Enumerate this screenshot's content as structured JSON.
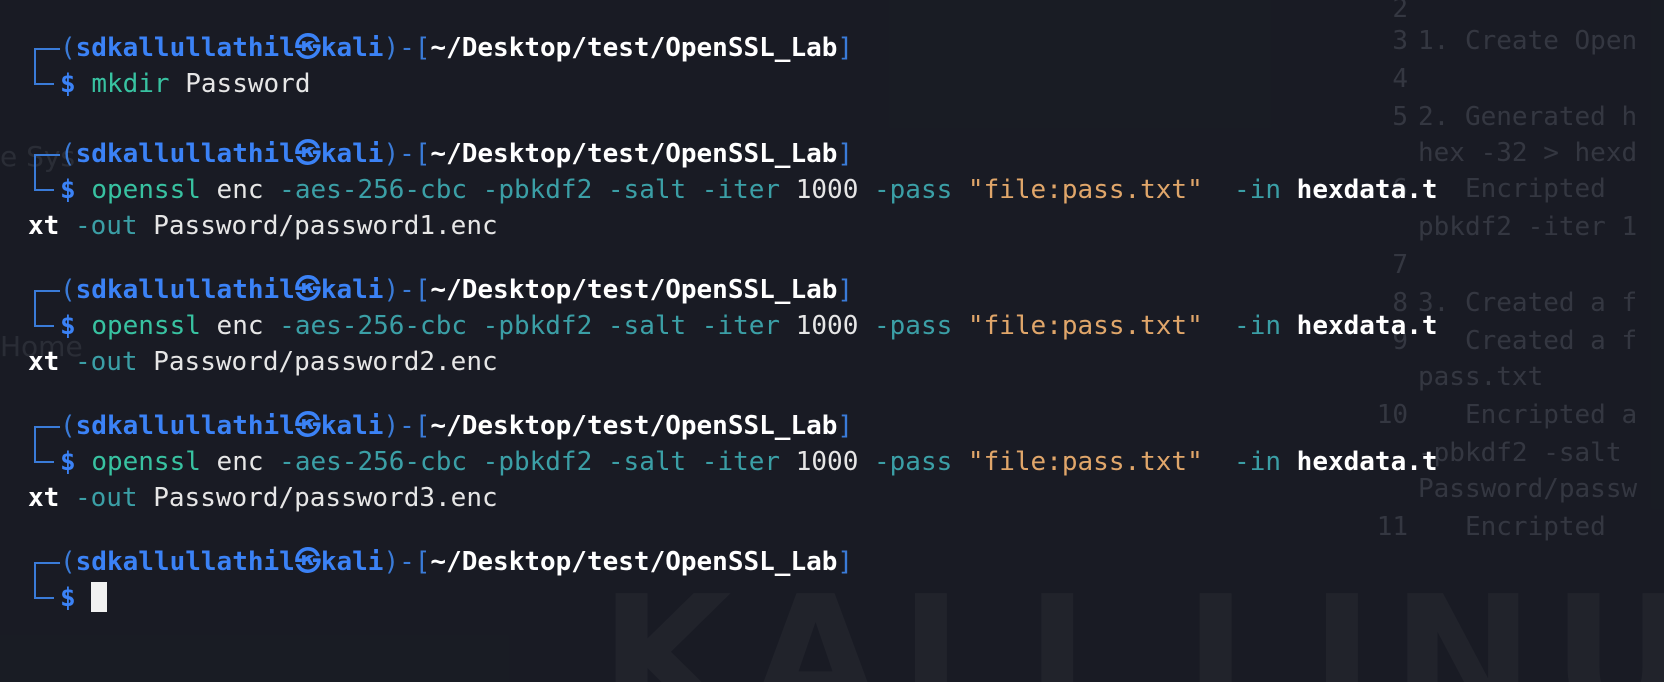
{
  "background": {
    "editor_lines": [
      {
        "num": "2",
        "text": ""
      },
      {
        "num": "3",
        "text": "1. Create Open"
      },
      {
        "num": "4",
        "text": ""
      },
      {
        "num": "5",
        "text": "2. Generated h"
      },
      {
        "num": "",
        "text": "hex -32 > hexd"
      },
      {
        "num": "6",
        "text": "   Encripted"
      },
      {
        "num": "",
        "text": "pbkdf2 -iter 1"
      },
      {
        "num": "7",
        "text": ""
      },
      {
        "num": "8",
        "text": "3. Created a f"
      },
      {
        "num": "9",
        "text": "   Created a f"
      },
      {
        "num": "",
        "text": "pass.txt"
      },
      {
        "num": "10",
        "text": "   Encripted a"
      },
      {
        "num": "",
        "text": "-pbkdf2 -salt"
      },
      {
        "num": "",
        "text": "Password/passw"
      },
      {
        "num": "11",
        "text": "   Encripted"
      }
    ],
    "side_text": [
      "e Sys",
      "",
      "",
      "",
      "",
      "Home"
    ],
    "watermark": "KALI LINUX"
  },
  "prompt": {
    "user": "sdkallullathil",
    "at_symbol": "㉿",
    "host": "kali",
    "path": "~/Desktop/test/OpenSSL_Lab",
    "dollar": "$"
  },
  "commands": [
    {
      "line1": [
        {
          "cls": "cmd",
          "text": "mkdir"
        },
        {
          "cls": "plain",
          "text": " Password"
        }
      ],
      "line2": []
    },
    {
      "line1": [
        {
          "cls": "cmd",
          "text": "openssl"
        },
        {
          "cls": "plain",
          "text": " enc "
        },
        {
          "cls": "opt",
          "text": "-aes-256-cbc -pbkdf2 -salt -iter"
        },
        {
          "cls": "plain",
          "text": " 1000 "
        },
        {
          "cls": "opt",
          "text": "-pass"
        },
        {
          "cls": "str",
          "text": " \"file:pass.txt\""
        },
        {
          "cls": "opt",
          "text": "  -in"
        },
        {
          "cls": "bold",
          "text": " hexdata.t"
        }
      ],
      "line2": [
        {
          "cls": "bold",
          "text": "xt"
        },
        {
          "cls": "opt",
          "text": " -out"
        },
        {
          "cls": "plain",
          "text": " Password/password1.enc"
        }
      ]
    },
    {
      "line1": [
        {
          "cls": "cmd",
          "text": "openssl"
        },
        {
          "cls": "plain",
          "text": " enc "
        },
        {
          "cls": "opt",
          "text": "-aes-256-cbc -pbkdf2 -salt -iter"
        },
        {
          "cls": "plain",
          "text": " 1000 "
        },
        {
          "cls": "opt",
          "text": "-pass"
        },
        {
          "cls": "str",
          "text": " \"file:pass.txt\""
        },
        {
          "cls": "opt",
          "text": "  -in"
        },
        {
          "cls": "bold",
          "text": " hexdata.t"
        }
      ],
      "line2": [
        {
          "cls": "bold",
          "text": "xt"
        },
        {
          "cls": "opt",
          "text": " -out"
        },
        {
          "cls": "plain",
          "text": " Password/password2.enc"
        }
      ]
    },
    {
      "line1": [
        {
          "cls": "cmd",
          "text": "openssl"
        },
        {
          "cls": "plain",
          "text": " enc "
        },
        {
          "cls": "opt",
          "text": "-aes-256-cbc -pbkdf2 -salt -iter"
        },
        {
          "cls": "plain",
          "text": " 1000 "
        },
        {
          "cls": "opt",
          "text": "-pass"
        },
        {
          "cls": "str",
          "text": " \"file:pass.txt\""
        },
        {
          "cls": "opt",
          "text": "  -in"
        },
        {
          "cls": "bold",
          "text": " hexdata.t"
        }
      ],
      "line2": [
        {
          "cls": "bold",
          "text": "xt"
        },
        {
          "cls": "opt",
          "text": " -out"
        },
        {
          "cls": "plain",
          "text": " Password/password3.enc"
        }
      ]
    },
    {
      "line1": [],
      "line2": [],
      "cursor": true
    }
  ],
  "colors": {
    "frame": "#3a7bd8",
    "user": "#3b82f6",
    "command": "#38c2a1",
    "option": "#3b9fa6",
    "string": "#e0a66a",
    "text": "#e6e6e6"
  }
}
